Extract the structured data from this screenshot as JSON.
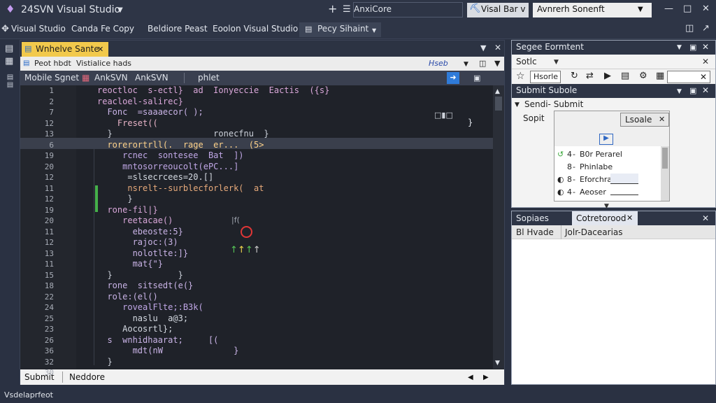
{
  "app": {
    "title": "24SVN Visual Studio",
    "search_label": "AnxiCore",
    "extension_label": "Visal Bar v",
    "account_label": "Avnrerh Sonenft"
  },
  "menu": {
    "items": [
      "Visual Studio",
      "Canda Fe Copy",
      "Beldiore Peast",
      "Eoolon Visual Studio",
      "Pecy Sihaint"
    ]
  },
  "editor": {
    "tab_label": "Wnhelve Sante",
    "path_label": "Peot hbdt",
    "path_sub": "Vistialice hads",
    "path_hint": "Hseb",
    "crumbs": [
      "Mobile Sgnet",
      "AnkSVN",
      "AnkSVN",
      "phlet"
    ],
    "lines": [
      {
        "n": "1",
        "t": "reoctloc  s-ectl}  ad  Ionyeccie  Eactis  ({s}",
        "c": "#d9a7d9"
      },
      {
        "n": "2",
        "t": "reacloel-salirec}",
        "c": "#d9a7d9"
      },
      {
        "n": "7",
        "t": "  Fonc  =saaaecor( );",
        "c": "#c9b3e6"
      },
      {
        "n": "12",
        "t": "    Freset((",
        "c": "#e7b3c7"
      },
      {
        "n": "13",
        "t": "  }                    ronecfnu  }",
        "c": "#cdd2db"
      },
      {
        "n": "6",
        "t": "  rorerortrll(.  rage  er...  (5>",
        "c": "#ffd38b"
      },
      {
        "n": "19",
        "t": "     rcnec  sontesee  Bat  ])",
        "c": "#c0a7e6"
      },
      {
        "n": "20",
        "t": "     mntosorreoucolt(ePC...]",
        "c": "#c0a7e6"
      },
      {
        "n": "12",
        "t": "      =slsecrcees=20.[]",
        "c": "#d5dae2"
      },
      {
        "n": "11",
        "t": "      nsrelt--surblecforlerk(  at",
        "c": "#e6a97a"
      },
      {
        "n": "12",
        "t": "      }",
        "c": "#cdd2db"
      },
      {
        "n": "19",
        "t": "  rone-fil|}",
        "c": "#d9a7d9"
      },
      {
        "n": "20",
        "t": "     reetacae()",
        "c": "#d9a7d9"
      },
      {
        "n": "11",
        "t": "       ebeoste:5}",
        "c": "#c9b3e6"
      },
      {
        "n": "12",
        "t": "       rajoc:(3)",
        "c": "#c9b3e6"
      },
      {
        "n": "13",
        "t": "       nolotlte:]}",
        "c": "#c9b3e6"
      },
      {
        "n": "11",
        "t": "       mat{\"}",
        "c": "#c9b3e6"
      },
      {
        "n": "15",
        "t": "  }             }",
        "c": "#cdd2db"
      },
      {
        "n": "18",
        "t": "  rone  sitsedt(e(}",
        "c": "#c9b3e6"
      },
      {
        "n": "22",
        "t": "  role:(el()",
        "c": "#c9b3e6"
      },
      {
        "n": "24",
        "t": "     rovealFlte;:B3k(",
        "c": "#c0a7e6"
      },
      {
        "n": "25",
        "t": "       naslu  a@3;",
        "c": "#d5dae2"
      },
      {
        "n": "23",
        "t": "     Aocosrtl};",
        "c": "#d5dae2"
      },
      {
        "n": "26",
        "t": "  s  wnhidhaarat;     [(",
        "c": "#c9b3e6"
      },
      {
        "n": "36",
        "t": "       mdt(nW              }",
        "c": "#c9b3e6"
      },
      {
        "n": "32",
        "t": "  }",
        "c": "#cdd2db"
      },
      {
        "n": "30",
        "t": "",
        "c": "#cdd2db"
      }
    ],
    "status_left": "Submit",
    "status_right": "Neddore"
  },
  "solution_panel": {
    "title": "Segee Eormtent",
    "search_label": "Sotlc",
    "filter_label": "Hsorle",
    "sub_title": "Submit Subole",
    "tree_root": "Sendi- Submit",
    "field_label": "Sopit",
    "dropdown_label": "Lsoale",
    "list_items": [
      {
        "n": "4",
        "t": "B0r Perarel"
      },
      {
        "n": "8",
        "t": "Phinlabe"
      },
      {
        "n": "8",
        "t": "Eforchra"
      },
      {
        "n": "4",
        "t": "Aeoser"
      }
    ]
  },
  "output_panel": {
    "tab1": "Sopiaes",
    "tab2": "Cotretorood",
    "col1": "Bl Hvade",
    "col2": "Jolr-Dacearias"
  },
  "bottom": {
    "status": "Vsdelaprfeot"
  }
}
